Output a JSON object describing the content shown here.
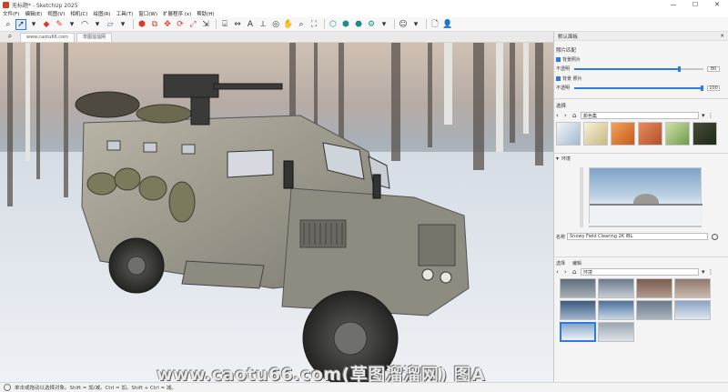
{
  "window": {
    "title": "无标题* - SketchUp 2025",
    "controls": [
      "—",
      "☐",
      "✕"
    ]
  },
  "menu": [
    "文件(F)",
    "编辑(E)",
    "视图(V)",
    "相机(C)",
    "绘图(R)",
    "工具(T)",
    "窗口(W)",
    "扩展程序 (x)",
    "帮助(H)"
  ],
  "tabs": [
    "www.caotu66.com",
    "草图溜溜网"
  ],
  "panel": {
    "title": "默认面板",
    "photo_match": {
      "title": "照片匹配",
      "bg_photo_label": "背景照片",
      "opacity1_label": "不透明",
      "opacity1_value": "80",
      "bg_photo2_label": "背景 照片",
      "opacity2_label": "不透明",
      "opacity2_value": "100"
    },
    "select_section": {
      "title": "选择",
      "collection": "颜色集"
    },
    "environment": {
      "title": "环境",
      "name_label": "名称",
      "name_value": "Snowy Field Clearing 2K IBL",
      "tab_select": "选择",
      "tab_edit": "编辑",
      "dropdown": "环境"
    }
  },
  "status": {
    "text": "单击或拖动以选择对象。Shift = 加/减。Ctrl = 加。Shift + Ctrl = 减。"
  },
  "watermark": "www.caotu66.com(草图溜溜网) 图A",
  "colors": {
    "accent": "#2c7be5",
    "brand": "#d83b26"
  }
}
